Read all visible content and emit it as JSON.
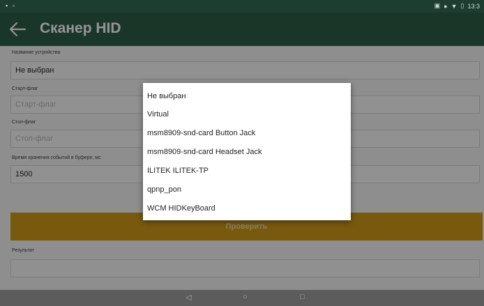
{
  "status_bar": {
    "left": "▪ ▫",
    "time": "13:3"
  },
  "app_bar": {
    "title": "Сканер HID"
  },
  "form": {
    "device_label": "Название устройства",
    "device_value": "Не выбран",
    "start_flag_label": "Старт-флаг",
    "start_flag_placeholder": "Старт-флаг",
    "stop_flag_label": "Стоп-флаг",
    "stop_flag_placeholder": "Стоп-флаг",
    "buffer_time_label": "Время хранения событий в буфере, мс",
    "buffer_time_value": "1500",
    "check_button": "Проверить",
    "result_label": "Результат"
  },
  "dropdown": {
    "options": [
      "Не выбран",
      "Virtual",
      "msm8909-snd-card Button Jack",
      "msm8909-snd-card Headset Jack",
      "ILITEK ILITEK-TP",
      "qpnp_pon",
      "WCM HIDKeyBoard"
    ]
  },
  "colors": {
    "app_bar": "#2e5e47",
    "status_bar": "#1e3d31",
    "button": "#cf9a19"
  }
}
